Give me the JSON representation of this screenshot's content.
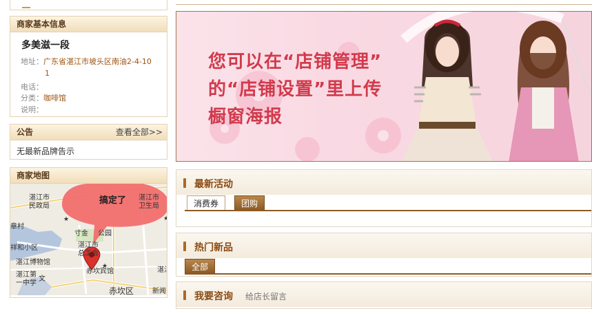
{
  "shop_info": {
    "header": "商家基本信息",
    "name": "多美滋一段",
    "address_label": "地址：",
    "address_value_line1": "广东省湛江市坡头区南油2-4-10",
    "address_value_line2": "1",
    "phone_label": "电话：",
    "phone_value": "",
    "category_label": "分类：",
    "category_value": "咖啡馆",
    "desc_label": "说明："
  },
  "notice": {
    "header": "公告",
    "view_all": "查看全部>>",
    "text": "无最新品牌告示"
  },
  "map": {
    "header": "商家地图",
    "bubble": "搞定了",
    "labels": [
      "湛江市",
      "民政局",
      "湛江市",
      "卫生局",
      "章村",
      "寸金",
      "公园",
      "湛江市",
      "总工会",
      "祥和小区",
      "湛江博物馆",
      "湛江第",
      "一中学",
      "文",
      "赤坎宾馆",
      "赤坎区",
      "新闻",
      "湛江市"
    ]
  },
  "banner": {
    "line1": "您可以在“店铺管理”",
    "line2": "的“店铺设置”里上传",
    "line3": "橱窗海报"
  },
  "latest": {
    "title": "最新活动",
    "tabs": [
      "消费券",
      "团购"
    ]
  },
  "hot": {
    "title": "热门新品",
    "tabs": [
      "全部"
    ]
  },
  "bottom": {
    "title": "我要咨询",
    "subtitle": "给店长留言"
  },
  "colors": {
    "accent": "#8c5a24",
    "banner_text": "#d23a4c",
    "bubble": "#f26a6a"
  }
}
